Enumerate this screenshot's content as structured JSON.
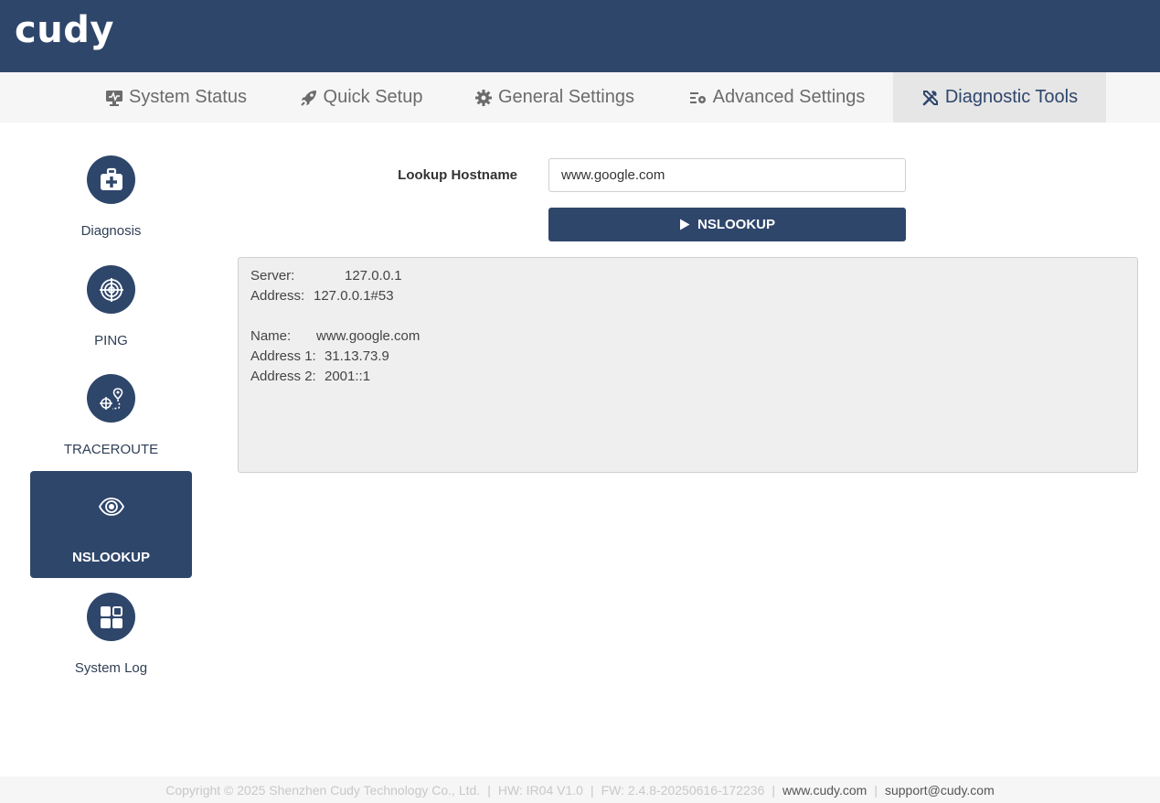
{
  "header": {
    "logo": "cudy"
  },
  "nav": {
    "tabs": [
      {
        "label": "System Status",
        "icon": "monitor-icon"
      },
      {
        "label": "Quick Setup",
        "icon": "rocket-icon"
      },
      {
        "label": "General Settings",
        "icon": "gear-icon"
      },
      {
        "label": "Advanced Settings",
        "icon": "advanced-settings-icon"
      },
      {
        "label": "Diagnostic Tools",
        "icon": "wrench-screwdriver-icon",
        "active": true
      }
    ]
  },
  "sidebar": {
    "items": [
      {
        "label": "Diagnosis",
        "icon": "medical-kit-icon"
      },
      {
        "label": "PING",
        "icon": "target-icon"
      },
      {
        "label": "TRACEROUTE",
        "icon": "route-pin-icon"
      },
      {
        "label": "NSLOOKUP",
        "icon": "eye-icon",
        "active": true
      },
      {
        "label": "System Log",
        "icon": "grid-icon"
      }
    ]
  },
  "form": {
    "label": "Lookup Hostname",
    "hostname_value": "www.google.com",
    "button_label": "NSLOOKUP"
  },
  "output": {
    "server_key": "Server:",
    "server_value": "127.0.0.1",
    "address_key": "Address:",
    "address_value": "127.0.0.1#53",
    "name_key": "Name:",
    "name_value": "www.google.com",
    "address1_key": "Address 1:",
    "address1_value": "31.13.73.9",
    "address2_key": "Address 2:",
    "address2_value": "2001::1"
  },
  "footer": {
    "copyright": "Copyright © 2025 Shenzhen Cudy Technology Co., Ltd.",
    "hw": "HW: IR04 V1.0",
    "fw": "FW: 2.4.8-20250616-172236",
    "website": "www.cudy.com",
    "email": "support@cudy.com",
    "separator": "|"
  },
  "colors": {
    "brand": "#2f466b",
    "nav_bg": "#f6f6f6",
    "output_bg": "#efefef"
  }
}
